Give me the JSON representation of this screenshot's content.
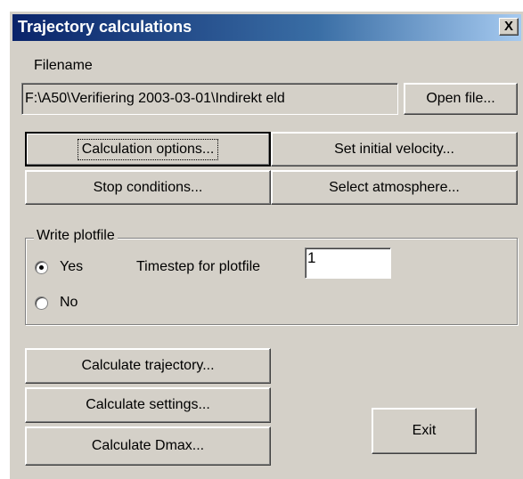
{
  "window": {
    "title": "Trajectory calculations",
    "close_glyph": "X"
  },
  "filename": {
    "label": "Filename",
    "value": "F:\\A50\\Verifiering 2003-03-01\\Indirekt eld",
    "open_button": "Open file..."
  },
  "options": {
    "calculation_options": "Calculation options...",
    "set_initial_velocity": "Set initial velocity...",
    "stop_conditions": "Stop conditions...",
    "select_atmosphere": "Select atmosphere..."
  },
  "plotfile": {
    "group_title": "Write plotfile",
    "yes_label": "Yes",
    "no_label": "No",
    "selected": "Yes",
    "timestep_label": "Timestep for plotfile",
    "timestep_value": "1"
  },
  "actions": {
    "calc_trajectory": "Calculate trajectory...",
    "calc_settings": "Calculate settings...",
    "calc_dmax": "Calculate Dmax...",
    "exit": "Exit"
  }
}
